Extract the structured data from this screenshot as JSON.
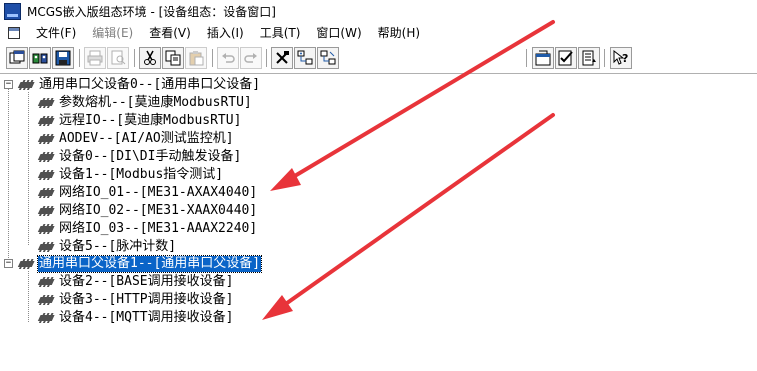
{
  "window": {
    "title": "MCGS嵌入版组态环境 - [设备组态：设备窗口]"
  },
  "menu": [
    {
      "label": "文件(F)",
      "enabled": true
    },
    {
      "label": "编辑(E)",
      "enabled": false
    },
    {
      "label": "查看(V)",
      "enabled": true
    },
    {
      "label": "插入(I)",
      "enabled": true
    },
    {
      "label": "工具(T)",
      "enabled": true
    },
    {
      "label": "窗口(W)",
      "enabled": true
    },
    {
      "label": "帮助(H)",
      "enabled": true
    }
  ],
  "toolbar": {
    "buttons": [
      {
        "icon": "new-window-icon"
      },
      {
        "icon": "device-window-icon"
      },
      {
        "icon": "save-icon"
      },
      {
        "icon": "print-icon"
      },
      {
        "icon": "print-preview-icon"
      },
      {
        "icon": "cut-icon"
      },
      {
        "icon": "copy-icon"
      },
      {
        "icon": "paste-icon"
      },
      {
        "icon": "undo-icon"
      },
      {
        "icon": "redo-icon"
      },
      {
        "icon": "toolbox-icon"
      },
      {
        "icon": "device-tree-icon"
      },
      {
        "icon": "device-tree-alt-icon"
      },
      {
        "icon": "properties-icon"
      },
      {
        "icon": "check-icon"
      },
      {
        "icon": "list-icon"
      },
      {
        "icon": "help-icon"
      }
    ]
  },
  "tree": {
    "nodes": [
      {
        "label": "通用串口父设备0--[通用串口父设备]",
        "level": 0,
        "expanded": true,
        "selected": false
      },
      {
        "label": "参数熔机--[莫迪康ModbusRTU]",
        "level": 1,
        "selected": false
      },
      {
        "label": "远程IO--[莫迪康ModbusRTU]",
        "level": 1,
        "selected": false
      },
      {
        "label": "AODEV--[AI/AO测试监控机]",
        "level": 1,
        "selected": false
      },
      {
        "label": "设备0--[DI\\DI手动触发设备]",
        "level": 1,
        "selected": false
      },
      {
        "label": "设备1--[Modbus指令测试]",
        "level": 1,
        "selected": false
      },
      {
        "label": "网络IO_01--[ME31-AXAX4040]",
        "level": 1,
        "selected": false
      },
      {
        "label": "网络IO_02--[ME31-XAAX0440]",
        "level": 1,
        "selected": false
      },
      {
        "label": "网络IO_03--[ME31-AAAX2240]",
        "level": 1,
        "selected": false
      },
      {
        "label": "设备5--[脉冲计数]",
        "level": 1,
        "selected": false
      },
      {
        "label": "通用串口父设备1--[通用串口父设备]",
        "level": 0,
        "expanded": true,
        "selected": true
      },
      {
        "label": "设备2--[BASE调用接收设备]",
        "level": 1,
        "selected": false
      },
      {
        "label": "设备3--[HTTP调用接收设备]",
        "level": 1,
        "selected": false
      },
      {
        "label": "设备4--[MQTT调用接收设备]",
        "level": 1,
        "selected": false
      }
    ]
  },
  "colors": {
    "selection": "#0a64c8",
    "annotation_arrow": "#e8343a",
    "chip": "#505050"
  }
}
